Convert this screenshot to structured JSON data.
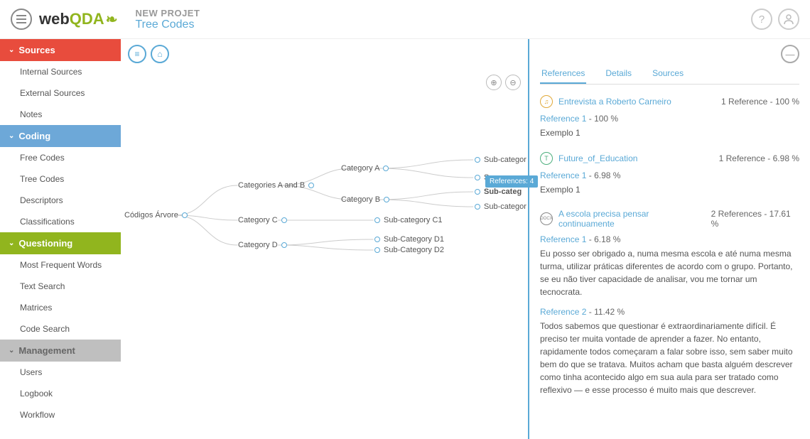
{
  "header": {
    "project_name": "NEW PROJET",
    "breadcrumb": "Tree Codes",
    "logo_web": "web",
    "logo_qda": "QDA"
  },
  "sidebar": {
    "sections": [
      {
        "label": "Sources",
        "items": [
          "Internal Sources",
          "External Sources",
          "Notes"
        ]
      },
      {
        "label": "Coding",
        "items": [
          "Free Codes",
          "Tree Codes",
          "Descriptors",
          "Classifications"
        ]
      },
      {
        "label": "Questioning",
        "items": [
          "Most Frequent Words",
          "Text Search",
          "Matrices",
          "Code Search"
        ]
      },
      {
        "label": "Management",
        "items": [
          "Users",
          "Logbook",
          "Workflow"
        ]
      }
    ]
  },
  "tree": {
    "root": "Códigos Árvore",
    "l1": [
      "Categories A and B",
      "Category C",
      "Category D"
    ],
    "l2a": [
      "Category A",
      "Category B"
    ],
    "l2c": [
      "Sub-category C1"
    ],
    "l2d": [
      "Sub-Category D1",
      "Sub-Category D2"
    ],
    "l3": [
      "Sub-categor",
      "S",
      "Sub-categ",
      "Sub-categor"
    ],
    "tooltip": "References: 4"
  },
  "right": {
    "tabs": [
      "References",
      "Details",
      "Sources"
    ],
    "sources": [
      {
        "icon": "audio",
        "title": "Entrevista a Roberto Carneiro",
        "meta": "1 Reference - 100 %",
        "refs": [
          {
            "label": "Reference 1",
            "pct": "100 %",
            "text": "Exemplo 1"
          }
        ]
      },
      {
        "icon": "text",
        "title": "Future_of_Education",
        "meta": "1 Reference - 6.98 %",
        "refs": [
          {
            "label": "Reference 1",
            "pct": "6.98 %",
            "text": "Exemplo 1"
          }
        ]
      },
      {
        "icon": "docx",
        "title": "A escola precisa pensar continuamente",
        "meta": "2 References - 17.61 %",
        "refs": [
          {
            "label": "Reference 1",
            "pct": "6.18 %",
            "text": "Eu posso ser obrigado a, numa mesma escola e até numa mesma turma, utilizar práticas diferentes de acordo com o grupo. Portanto, se eu não tiver capacidade de analisar, vou me tornar um tecnocrata."
          },
          {
            "label": "Reference 2",
            "pct": "11.42 %",
            "text": "Todos sabemos que questionar é extraordinariamente difícil. É preciso ter muita vontade de aprender a fazer. No entanto, rapidamente todos começaram a falar sobre isso, sem saber muito bem do que se tratava. Muitos acham que basta alguém descrever como tinha acontecido algo em sua aula para ser tratado como reflexivo — e esse processo é muito mais que descrever."
          }
        ]
      }
    ]
  }
}
